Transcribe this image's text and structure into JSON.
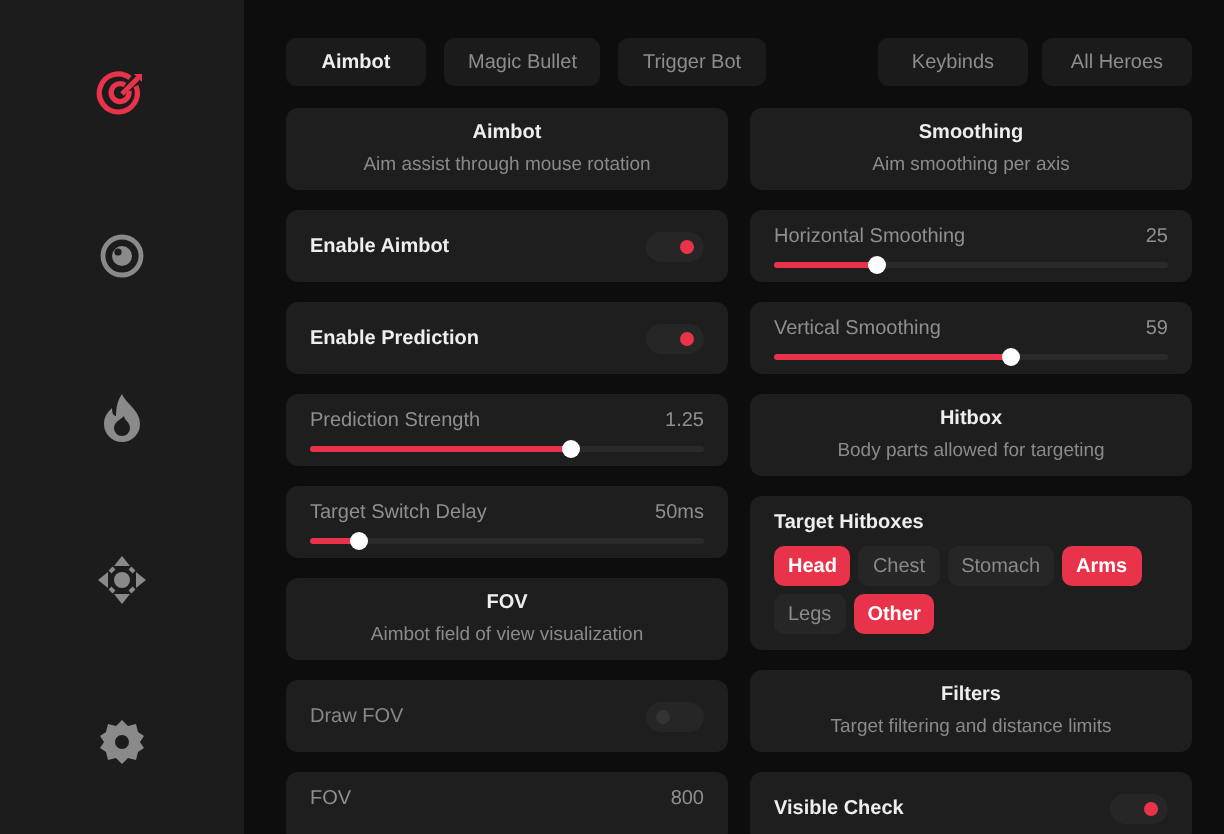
{
  "sidebar": {
    "items": [
      {
        "kind": "target",
        "selected": true
      },
      {
        "kind": "eye",
        "selected": false
      },
      {
        "kind": "flame",
        "selected": false
      },
      {
        "kind": "move",
        "selected": false
      },
      {
        "kind": "gear",
        "selected": false
      }
    ]
  },
  "tabs": [
    {
      "label": "Aimbot",
      "selected": true
    },
    {
      "label": "Magic Bullet",
      "selected": false
    },
    {
      "label": "Trigger Bot",
      "selected": false
    }
  ],
  "buttons": [
    "Keybinds",
    "All Heroes"
  ],
  "columns": [
    {
      "cards": [
        {
          "kind": "header",
          "title": "Aimbot",
          "subtitle": "Aim assist through mouse rotation"
        },
        {
          "kind": "toggle",
          "label": "Enable Aimbot",
          "on": true
        },
        {
          "kind": "toggle",
          "label": "Enable Prediction",
          "on": true
        },
        {
          "kind": "slider",
          "label": "Prediction Strength",
          "value": "1.25",
          "level": 0.66
        },
        {
          "kind": "slider",
          "label": "Target Switch Delay",
          "value": "50ms",
          "level": 0.12
        },
        {
          "kind": "header",
          "title": "FOV",
          "subtitle": "Aimbot field of view visualization"
        },
        {
          "kind": "toggle",
          "label": "Draw FOV",
          "on": false
        },
        {
          "kind": "slider",
          "label": "FOV",
          "value": "800"
        }
      ]
    },
    {
      "cards": [
        {
          "kind": "header",
          "title": "Smoothing",
          "subtitle": "Aim smoothing per axis"
        },
        {
          "kind": "slider",
          "label": "Horizontal Smoothing",
          "value": "25",
          "level": 0.26
        },
        {
          "kind": "slider",
          "label": "Vertical Smoothing",
          "value": "59",
          "level": 0.6
        },
        {
          "kind": "header",
          "title": "Hitbox",
          "subtitle": "Body parts allowed for targeting"
        },
        {
          "kind": "chips",
          "label": "Target Hitboxes",
          "chips": [
            {
              "label": "Head",
              "selected": true
            },
            {
              "label": "Chest",
              "selected": false
            },
            {
              "label": "Stomach",
              "selected": false
            },
            {
              "label": "Arms",
              "selected": true
            },
            {
              "label": "Legs",
              "selected": false
            },
            {
              "label": "Other",
              "selected": true
            }
          ]
        },
        {
          "kind": "header",
          "title": "Filters",
          "subtitle": "Target filtering and distance limits"
        },
        {
          "kind": "toggle",
          "label": "Visible Check",
          "on": true
        }
      ]
    }
  ]
}
